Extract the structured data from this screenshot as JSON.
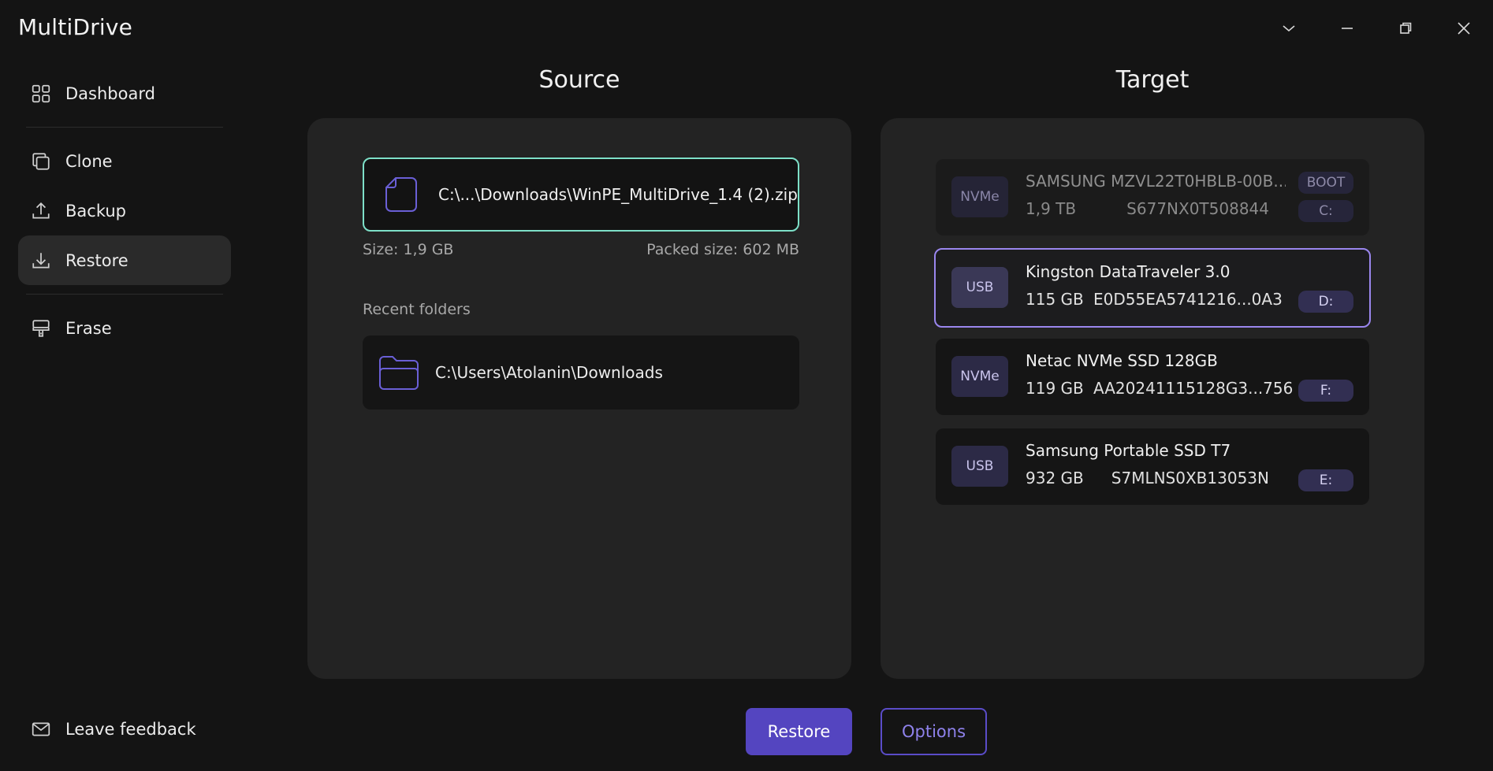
{
  "app": {
    "title": "MultiDrive"
  },
  "sidebar": {
    "items": [
      {
        "label": "Dashboard",
        "icon": "dashboard-icon"
      },
      {
        "label": "Clone",
        "icon": "clone-icon"
      },
      {
        "label": "Backup",
        "icon": "upload-icon"
      },
      {
        "label": "Restore",
        "icon": "download-icon",
        "active": true
      },
      {
        "label": "Erase",
        "icon": "eraser-icon"
      }
    ],
    "feedback_label": "Leave feedback"
  },
  "source": {
    "title": "Source",
    "file_path": "C:\\...\\Downloads\\WinPE_MultiDrive_1.4 (2).zip",
    "size_label": "Size:",
    "size_value": "1,9 GB",
    "packed_label": "Packed size:",
    "packed_value": "602 MB",
    "recent_label": "Recent folders",
    "recent_folders": [
      "C:\\Users\\Atolanin\\Downloads"
    ]
  },
  "target": {
    "title": "Target",
    "drives": [
      {
        "type": "NVMe",
        "name": "SAMSUNG MZVL22T0HBLB-00B...",
        "capacity": "1,9 TB",
        "serial": "S677NX0T508844",
        "tags": [
          "BOOT",
          "C:"
        ],
        "state": "disabled"
      },
      {
        "type": "USB",
        "name": "Kingston DataTraveler 3.0",
        "capacity": "115 GB",
        "serial": "E0D55EA5741216...0A3",
        "tags": [
          "D:"
        ],
        "state": "selected"
      },
      {
        "type": "NVMe",
        "name": "Netac NVMe SSD 128GB",
        "capacity": "119 GB",
        "serial": "AA20241115128G3...756",
        "tags": [
          "F:"
        ],
        "state": "normal"
      },
      {
        "type": "USB",
        "name": "Samsung Portable SSD T7",
        "capacity": "932 GB",
        "serial": "S7MLNS0XB13053N",
        "tags": [
          "E:"
        ],
        "state": "normal"
      }
    ]
  },
  "actions": {
    "primary_label": "Restore",
    "secondary_label": "Options"
  },
  "colors": {
    "accent": "#5445c0",
    "selected_border": "#9a86ee",
    "file_border": "#7de0c8"
  }
}
